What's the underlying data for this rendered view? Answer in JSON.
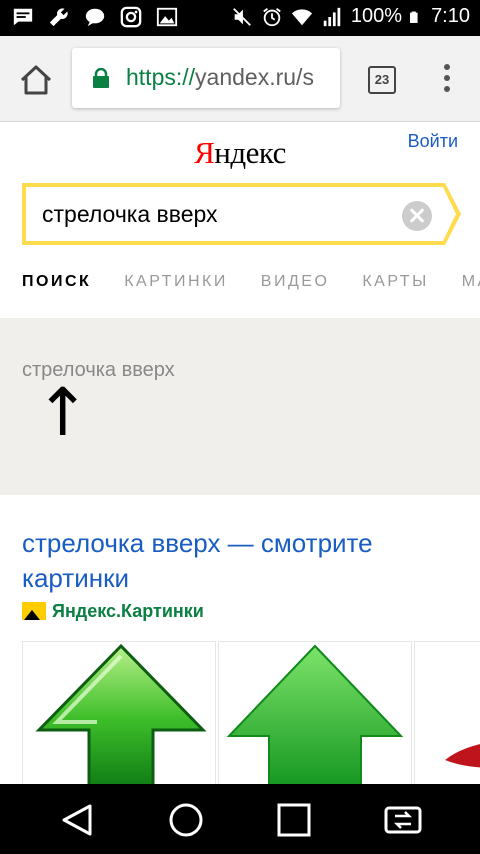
{
  "status_bar": {
    "battery": "100%",
    "time": "7:10",
    "left_icons": [
      "message-icon",
      "wrench-icon",
      "chat-icon",
      "instagram-icon",
      "image-icon"
    ],
    "right_icons": [
      "mute-icon",
      "alarm-icon",
      "wifi-icon",
      "signal-icon",
      "battery-icon"
    ]
  },
  "browser": {
    "url_scheme": "https://",
    "url_rest": "yandex.ru/s",
    "tab_count": "23",
    "secure_color": "#0b8043"
  },
  "header": {
    "logo_first": "Я",
    "logo_rest": "ндекс",
    "login": "Войти"
  },
  "search": {
    "query": "стрелочка вверх",
    "accent_color": "#ffdb4d"
  },
  "service_tabs": [
    {
      "label": "ПОИСК",
      "active": true
    },
    {
      "label": "КАРТИНКИ",
      "active": false
    },
    {
      "label": "ВИДЕО",
      "active": false
    },
    {
      "label": "КАРТЫ",
      "active": false
    },
    {
      "label": "МА",
      "active": false
    }
  ],
  "wizard": {
    "query": "стрелочка вверх",
    "symbol": "↑"
  },
  "result": {
    "title": "стрелочка вверх — смотрите картинки",
    "source": "Яндекс.Картинки",
    "link_color": "#1a5dc2"
  },
  "nav_bar": {
    "buttons": [
      "back-icon",
      "home-circle-icon",
      "recents-icon",
      "screen-switch-icon"
    ]
  }
}
